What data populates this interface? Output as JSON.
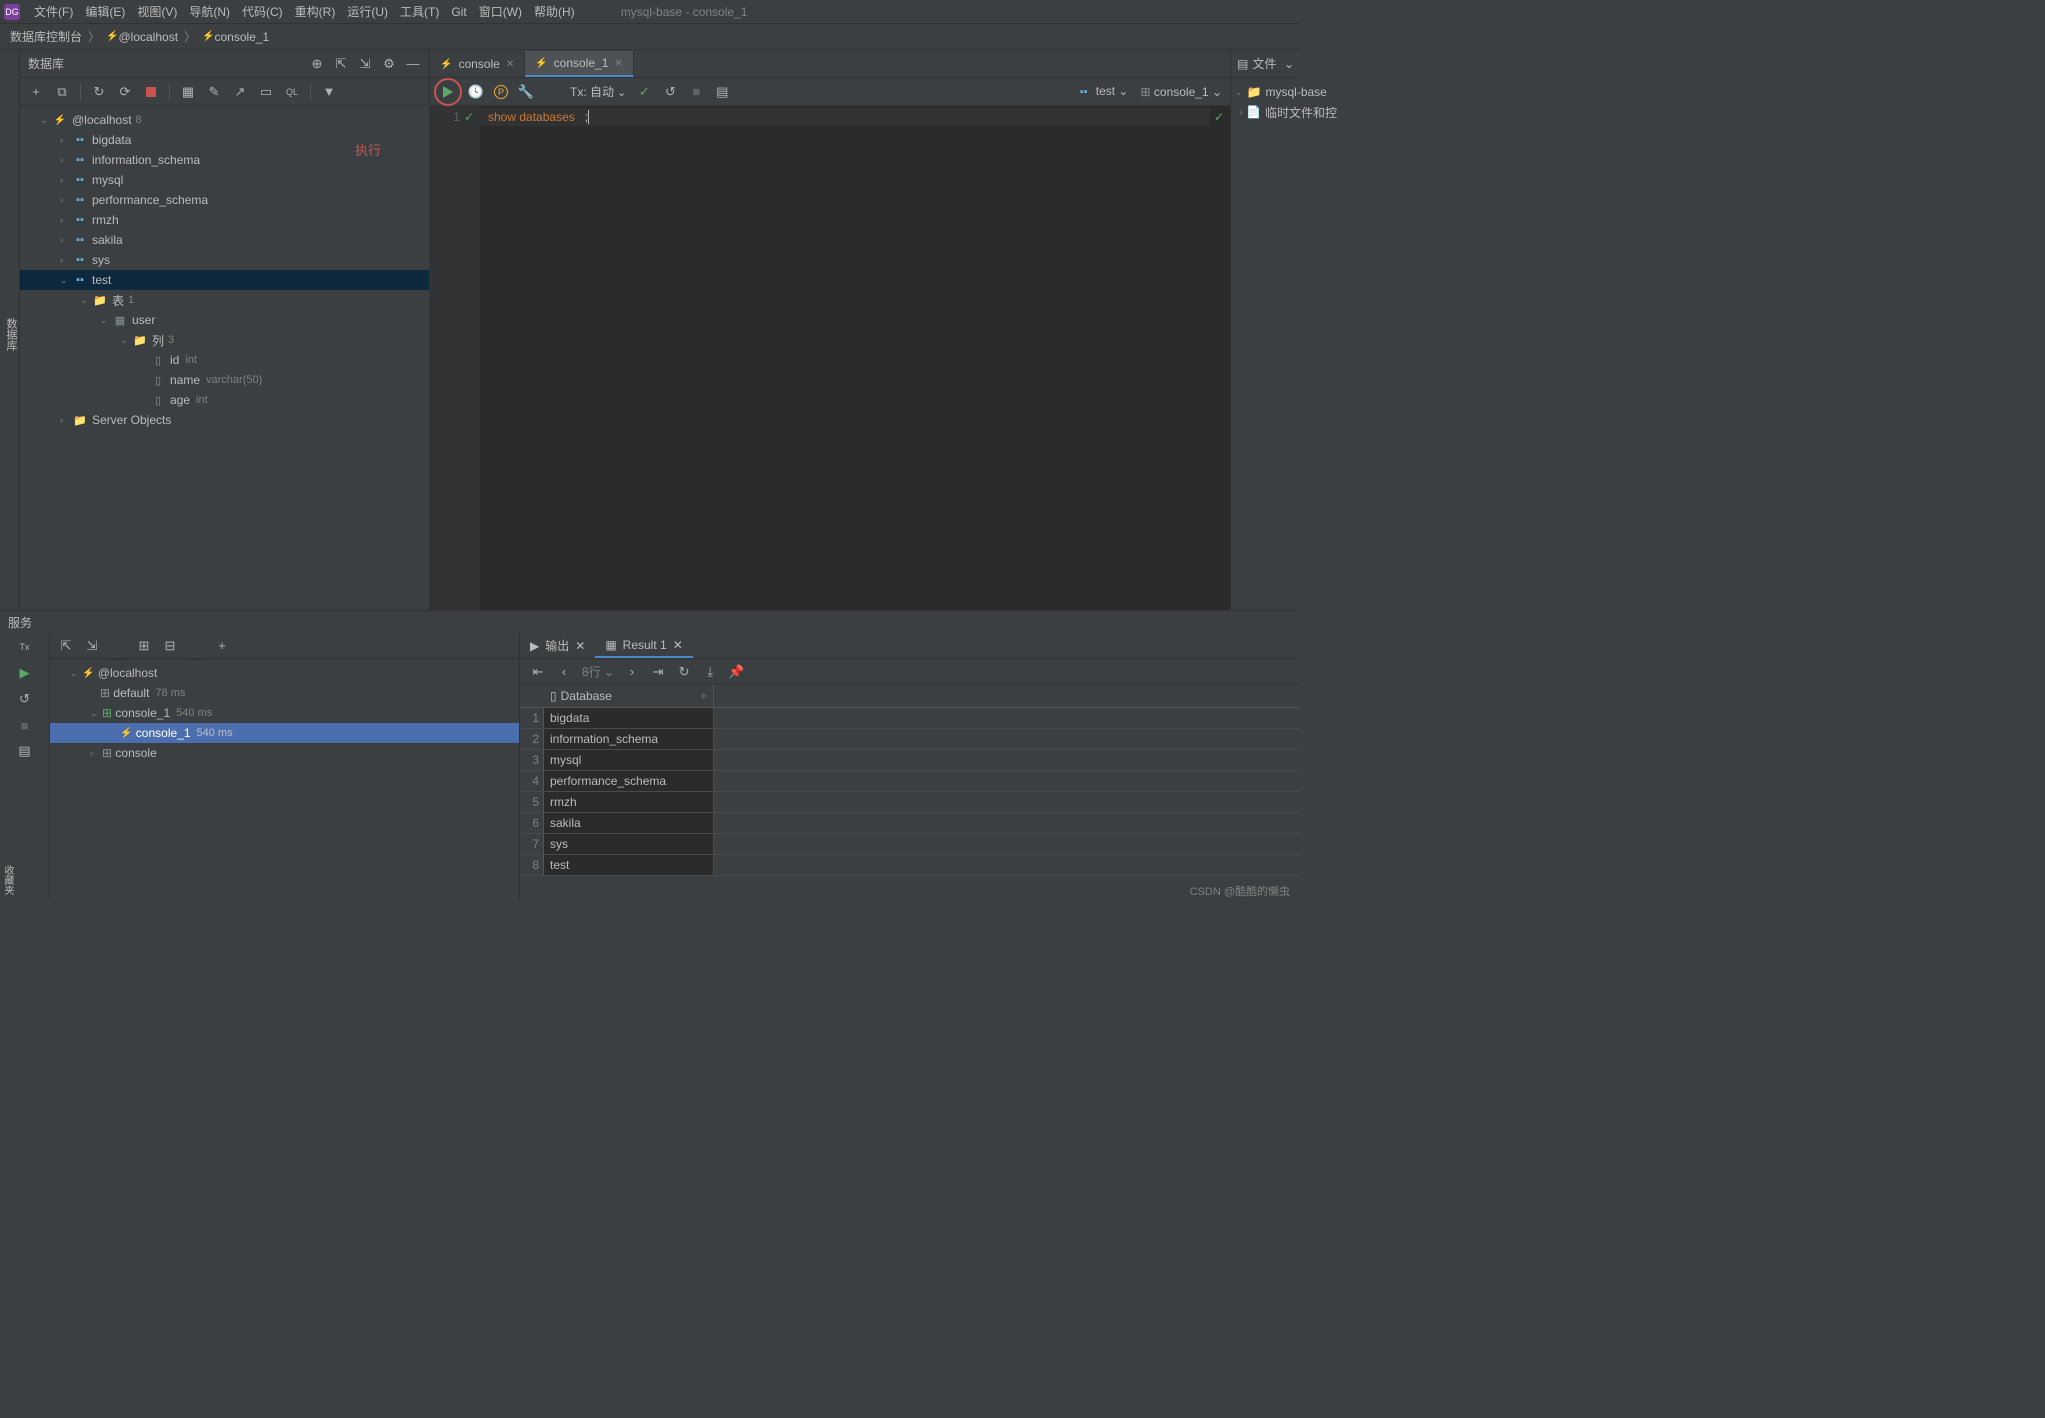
{
  "menubar": {
    "items": [
      "文件(F)",
      "编辑(E)",
      "视图(V)",
      "导航(N)",
      "代码(C)",
      "重构(R)",
      "运行(U)",
      "工具(T)",
      "Git",
      "窗口(W)",
      "帮助(H)"
    ],
    "title": "mysql-base - console_1"
  },
  "breadcrumb": {
    "items": [
      "数据库控制台",
      "@localhost",
      "console_1"
    ]
  },
  "side_tab": "数据库",
  "db_panel": {
    "title": "数据库",
    "datasource": {
      "name": "@localhost",
      "badge": "8"
    },
    "schemas": [
      "bigdata",
      "information_schema",
      "mysql",
      "performance_schema",
      "rmzh",
      "sakila",
      "sys"
    ],
    "selected_schema": "test",
    "tables_group": {
      "label": "表",
      "count": "1"
    },
    "table": "user",
    "columns_group": {
      "label": "列",
      "count": "3"
    },
    "columns": [
      {
        "name": "id",
        "type": "int"
      },
      {
        "name": "name",
        "type": "varchar(50)"
      },
      {
        "name": "age",
        "type": "int"
      }
    ],
    "server_objects": "Server Objects"
  },
  "editor": {
    "tabs": [
      {
        "label": "console",
        "active": false
      },
      {
        "label": "console_1",
        "active": true
      }
    ],
    "tx_label": "Tx: 自动",
    "datasource_badge": "test",
    "console_badge": "console_1",
    "line_no": "1",
    "code_kw1": "show",
    "code_kw2": "databases",
    "code_tail": ";",
    "annotation": "执行"
  },
  "files_panel": {
    "title": "文件",
    "root": "mysql-base",
    "child": "临时文件和控"
  },
  "services": {
    "title": "服务",
    "tree": {
      "host": "@localhost",
      "default": {
        "label": "default",
        "time": "78 ms"
      },
      "console1a": {
        "label": "console_1",
        "time": "540 ms"
      },
      "console1b": {
        "label": "console_1",
        "time": "540 ms"
      },
      "console": "console"
    },
    "result_tabs": {
      "output": "输出",
      "result": "Result 1"
    },
    "rows_label": "8行",
    "grid_header": "Database",
    "grid_rows": [
      "bigdata",
      "information_schema",
      "mysql",
      "performance_schema",
      "rmzh",
      "sakila",
      "sys",
      "test"
    ]
  },
  "watermark": "CSDN @酷酷的懒虫",
  "collapse_label": "收藏夹"
}
